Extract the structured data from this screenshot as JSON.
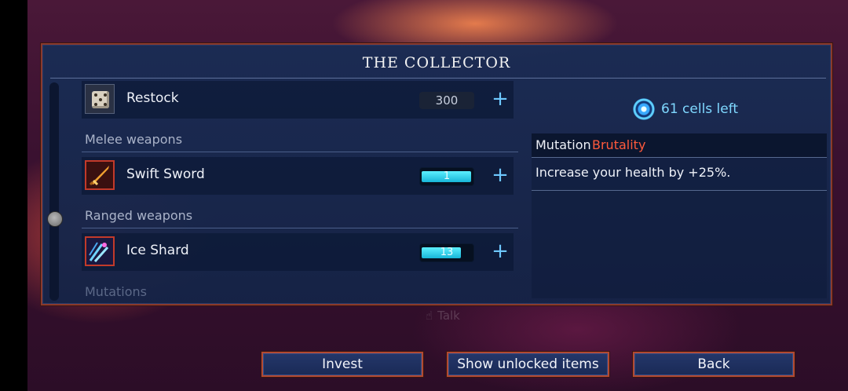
{
  "panel": {
    "title": "THE COLLECTOR"
  },
  "currency": {
    "cells_text": "61 cells left",
    "icon": "cell-icon"
  },
  "list": {
    "restock": {
      "label": "Restock",
      "cost": "300",
      "icon": "dice-icon"
    },
    "sections": [
      {
        "title": "Melee weapons",
        "items": [
          {
            "name": "Swift Sword",
            "invested": "1",
            "progress_fraction": 0.95,
            "icon": "sword-icon"
          }
        ]
      },
      {
        "title": "Ranged weapons",
        "items": [
          {
            "name": "Ice Shard",
            "invested": "13",
            "progress_fraction": 0.75,
            "icon": "ice-shard-icon"
          }
        ]
      },
      {
        "title": "Mutations",
        "items": []
      }
    ],
    "add_symbol": "+"
  },
  "detail": {
    "prefix": "Mutation",
    "name": "Brutality",
    "name_color": "#ff5a3c",
    "description": "Increase your health by +25%."
  },
  "background_hint": {
    "text": "Talk"
  },
  "buttons": {
    "invest": "Invest",
    "show_unlocked": "Show unlocked items",
    "back": "Back"
  },
  "colors": {
    "accent_cyan": "#5cf0ff",
    "frame_red": "#b24a33",
    "panel_blue": "#1a2c54"
  }
}
